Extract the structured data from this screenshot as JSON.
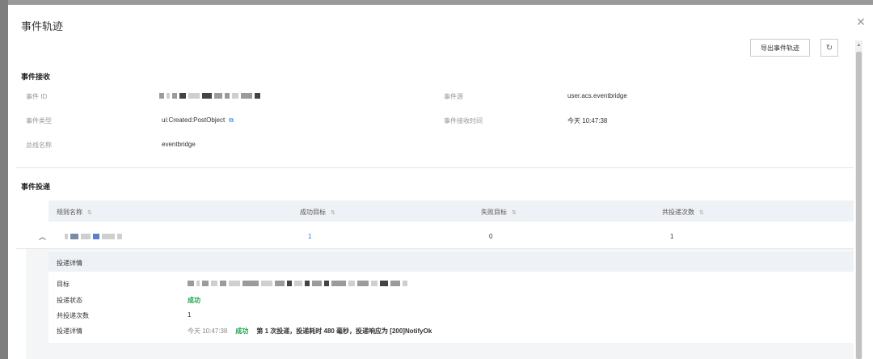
{
  "modal": {
    "title": "事件轨迹",
    "export_label": "导出事件轨迹"
  },
  "receive": {
    "section_title": "事件接收",
    "fields": {
      "event_id_label": "事件 ID",
      "event_type_label": "事件类型",
      "event_type_value": "ui:Created:PostObject",
      "bus_name_label": "总线名称",
      "bus_name_value": "eventbridge",
      "source_label": "事件源",
      "source_value": "user.acs.eventbridge",
      "receive_time_label": "事件接收时间",
      "receive_time_value": "今天 10:47:38"
    }
  },
  "delivery": {
    "section_title": "事件投递",
    "columns": [
      "规则名称",
      "成功目标",
      "失败目标",
      "共投递次数"
    ],
    "row": {
      "success_targets": "1",
      "failed_targets": "0",
      "total_deliveries": "1"
    },
    "detail": {
      "header": "投递详情",
      "target_label": "目标",
      "status_label": "投递状态",
      "status_value": "成功",
      "count_label": "共投递次数",
      "count_value": "1",
      "detail_label": "投递详情",
      "log_time": "今天 10:47:38",
      "log_status": "成功",
      "log_message": "第 1 次投递，投递耗时 480 毫秒，投递响应为 [200]NotifyOk"
    }
  },
  "colors": {
    "accent": "#1f7ae0",
    "success": "#1aa34a"
  }
}
